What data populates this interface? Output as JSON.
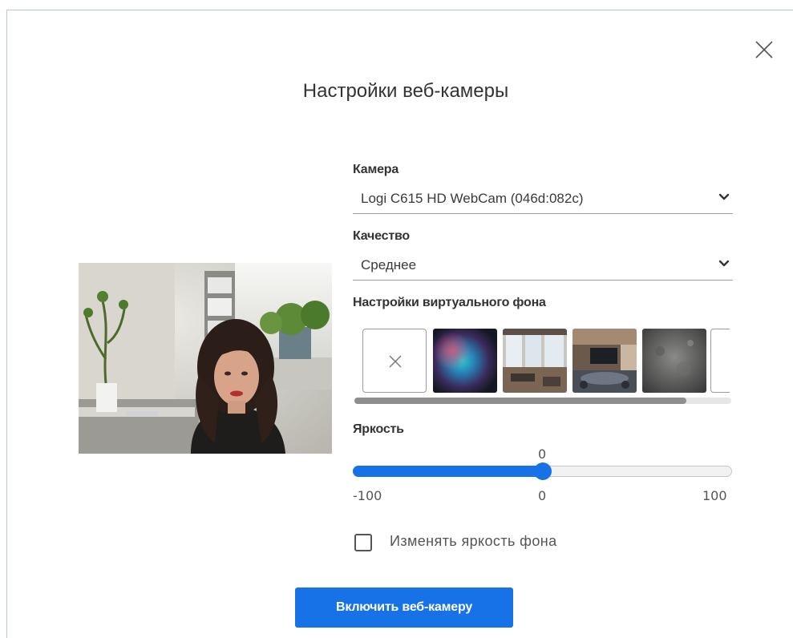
{
  "dialog": {
    "title": "Настройки веб-камеры",
    "close_icon": "close-icon"
  },
  "camera": {
    "label": "Камера",
    "value": "Logi C615 HD WebCam (046d:082c)",
    "icon": "chevron-down-icon"
  },
  "quality": {
    "label": "Качество",
    "value": "Среднее",
    "icon": "chevron-down-icon"
  },
  "virtual_background": {
    "label": "Настройки виртуального фона",
    "tiles": [
      {
        "name": "none",
        "icon": "close-icon"
      },
      {
        "name": "blur"
      },
      {
        "name": "office-windows"
      },
      {
        "name": "conference-room"
      },
      {
        "name": "stone-texture"
      },
      {
        "name": "more"
      }
    ],
    "scroll_position": 0.88
  },
  "brightness": {
    "label": "Яркость",
    "current": "0",
    "min": "-100",
    "mid": "0",
    "max": "100",
    "value": 0,
    "range": [
      -100,
      100
    ]
  },
  "background_brightness": {
    "label": "Изменять яркость фона",
    "checked": false
  },
  "actions": {
    "enable_label": "Включить веб-камеру"
  },
  "colors": {
    "accent": "#1672e6",
    "border": "#b8c4d8"
  }
}
